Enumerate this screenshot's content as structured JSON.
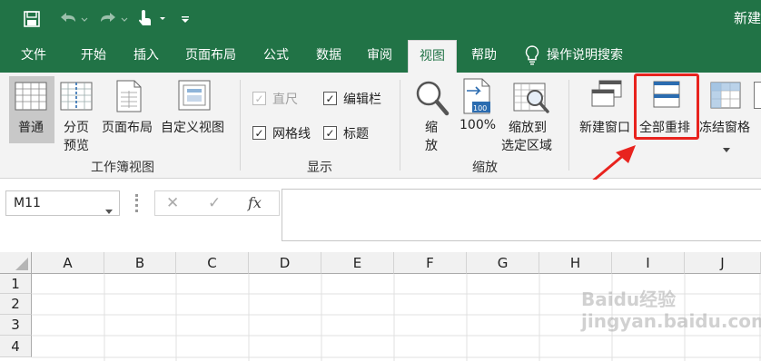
{
  "title_bar": {
    "title": "新建"
  },
  "tabs": [
    {
      "label": "文件",
      "active": false
    },
    {
      "label": "开始",
      "active": false
    },
    {
      "label": "插入",
      "active": false
    },
    {
      "label": "页面布局",
      "active": false
    },
    {
      "label": "公式",
      "active": false
    },
    {
      "label": "数据",
      "active": false
    },
    {
      "label": "审阅",
      "active": false
    },
    {
      "label": "视图",
      "active": true
    },
    {
      "label": "帮助",
      "active": false
    },
    {
      "label": "操作说明搜索",
      "active": false
    }
  ],
  "groups": {
    "workbook_views": {
      "label": "工作簿视图",
      "buttons": [
        {
          "label": "普通",
          "selected": true
        },
        {
          "label_line1": "分页",
          "label_line2": "预览"
        },
        {
          "label": "页面布局"
        },
        {
          "label": "自定义视图"
        }
      ]
    },
    "show": {
      "label": "显示",
      "checkboxes": [
        {
          "label": "直尺",
          "checked": true,
          "disabled": true
        },
        {
          "label": "编辑栏",
          "checked": true,
          "disabled": false
        },
        {
          "label": "网格线",
          "checked": true,
          "disabled": false
        },
        {
          "label": "标题",
          "checked": true,
          "disabled": false
        }
      ]
    },
    "zoom": {
      "label": "缩放",
      "buttons": [
        {
          "label_line1": "缩",
          "label_line2": "放"
        },
        {
          "label": "100%",
          "icon_text": "100"
        },
        {
          "label_line1": "缩放到",
          "label_line2": "选定区域"
        }
      ]
    },
    "window": {
      "buttons": [
        {
          "label": "新建窗口"
        },
        {
          "label": "全部重排",
          "highlighted": true
        },
        {
          "label": "冻结窗格"
        }
      ]
    }
  },
  "formula_bar": {
    "name_box": "M11",
    "cancel_symbol": "✕",
    "enter_symbol": "✓",
    "fx_symbol": "fx",
    "formula": ""
  },
  "sheet": {
    "columns": [
      "A",
      "B",
      "C",
      "D",
      "E",
      "F",
      "G",
      "H",
      "I",
      "J"
    ],
    "rows": [
      "1",
      "2",
      "3",
      "4"
    ]
  },
  "colors": {
    "brand": "#217346",
    "highlight": "#e8231e",
    "ribbon_bg": "#f3f3f3"
  },
  "watermark": "Baidu经验 jingyan.baidu.com"
}
